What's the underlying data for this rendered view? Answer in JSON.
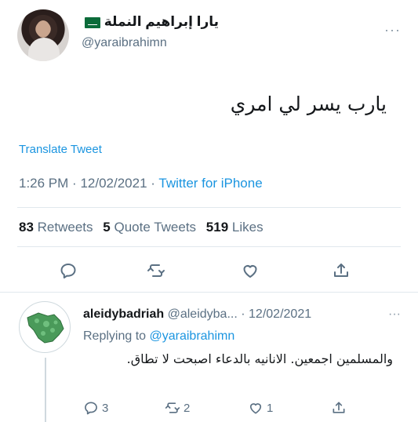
{
  "tweet": {
    "author_name": "يارا إبراهيم النملة",
    "author_handle": "@yaraibrahimn",
    "more": "···",
    "text": "يارب يسر لي امري",
    "translate_label": "Translate Tweet",
    "time": "1:26 PM",
    "date": "12/02/2021",
    "sep": "·",
    "source": "Twitter for iPhone",
    "stats": {
      "retweets_count": "83",
      "retweets_label": "Retweets",
      "quotes_count": "5",
      "quotes_label": "Quote Tweets",
      "likes_count": "519",
      "likes_label": "Likes"
    },
    "actions": [
      "reply-icon",
      "retweet-icon",
      "like-icon",
      "share-icon"
    ]
  },
  "reply": {
    "name": "aleidybadriah",
    "handle": "@aleidyba...",
    "sep": "·",
    "date": "12/02/2021",
    "more": "···",
    "replying_prefix": "Replying to",
    "replying_to": "@yaraibrahimn",
    "text": "والمسلمين اجمعين. الانانيه بالدعاء اصبحت لا تطاق.",
    "reply_count": "3",
    "retweet_count": "2",
    "like_count": "1"
  },
  "colors": {
    "link": "#1b95e0",
    "muted": "#5b7083",
    "text": "#14171a",
    "divider": "#e1e8ed",
    "flag_green": "#0b6b3a"
  }
}
